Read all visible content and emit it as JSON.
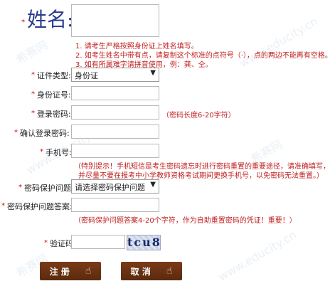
{
  "name_section": {
    "title": "姓名:",
    "instructions": [
      "1. 请考生严格按照身份证上姓名填写。",
      "2. 如考生姓名中带有点，请复制这个标准的点符号（·），点的两边不能再有空格。",
      "3. 如有所属难字请拼音使用，例：龚、仝。"
    ]
  },
  "form": {
    "id_type": {
      "label": "证件类型:",
      "value": "身份证"
    },
    "id_number": {
      "label": "身份证号:"
    },
    "password": {
      "label": "登录密码:",
      "hint": "（密码长度6-20字符）"
    },
    "confirm_password": {
      "label": "确认登录密码:"
    },
    "phone": {
      "label": "手机号:",
      "hint_line1": "（特别提示！手机短信是考生密码遗忘时进行密码重置的重要途径，请准确填写，",
      "hint_line2": "并尽量不要在报考中小学教师资格考试期间更换手机号，以免密码无法重置。）"
    },
    "security_question": {
      "label": "密码保护问题:",
      "value": "请选择密码保护问题"
    },
    "security_answer": {
      "label": "密码保护问题答案:",
      "hint": "（密码保护问题答案4-20个字符，作为自助重置密码的凭证！重要！）"
    },
    "captcha": {
      "label": "验证码",
      "image_text": "tcu8"
    }
  },
  "buttons": {
    "register": "注 册",
    "cancel": "取 消"
  },
  "required_mark": "*",
  "watermarks": [
    "希赛网",
    "www.educity.cn"
  ],
  "colors": {
    "title": "#2a3b8f",
    "hint": "#c02020",
    "button": "#6b3415"
  }
}
